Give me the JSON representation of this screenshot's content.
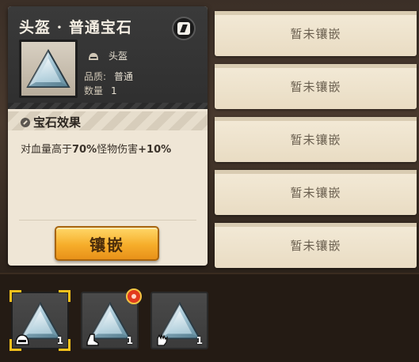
{
  "detail": {
    "title": "头盔 · 普通宝石",
    "equip_type": "头盔",
    "quality_label": "品质:",
    "quality_value": "普通",
    "quantity_label": "数量",
    "quantity_value": "1",
    "effect_title": "宝石效果",
    "effect_prefix": "对血量高于",
    "effect_threshold": "70%",
    "effect_middle": "怪物伤害",
    "effect_bonus": "+10%",
    "inlay_button": "镶嵌"
  },
  "sockets": [
    {
      "label": "暂未镶嵌"
    },
    {
      "label": "暂未镶嵌"
    },
    {
      "label": "暂未镶嵌"
    },
    {
      "label": "暂未镶嵌"
    },
    {
      "label": "暂未镶嵌"
    }
  ],
  "inventory": [
    {
      "type_icon": "helmet-icon",
      "count": "1",
      "selected": true,
      "new": false
    },
    {
      "type_icon": "boot-icon",
      "count": "1",
      "selected": false,
      "new": true
    },
    {
      "type_icon": "glove-icon",
      "count": "1",
      "selected": false,
      "new": false
    }
  ],
  "colors": {
    "accent": "#f6ad2a",
    "selection": "#f7c21c",
    "panel": "#efe6d6",
    "badge": "#e23b1e"
  }
}
